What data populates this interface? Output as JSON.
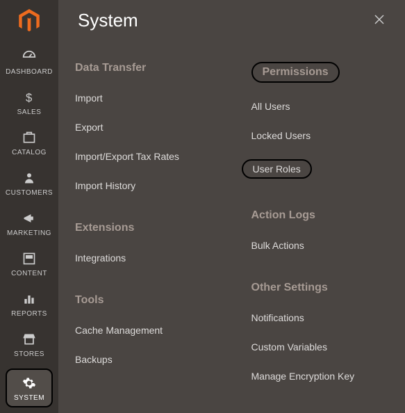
{
  "logo": {
    "alt": "Magento"
  },
  "sidebar": {
    "items": [
      {
        "label": "DASHBOARD"
      },
      {
        "label": "SALES"
      },
      {
        "label": "CATALOG"
      },
      {
        "label": "CUSTOMERS"
      },
      {
        "label": "MARKETING"
      },
      {
        "label": "CONTENT"
      },
      {
        "label": "REPORTS"
      },
      {
        "label": "STORES"
      },
      {
        "label": "SYSTEM"
      }
    ]
  },
  "panel": {
    "title": "System",
    "left": {
      "data_transfer": {
        "title": "Data Transfer",
        "items": [
          "Import",
          "Export",
          "Import/Export Tax Rates",
          "Import History"
        ]
      },
      "extensions": {
        "title": "Extensions",
        "items": [
          "Integrations"
        ]
      },
      "tools": {
        "title": "Tools",
        "items": [
          "Cache Management",
          "Backups"
        ]
      }
    },
    "right": {
      "permissions": {
        "title": "Permissions",
        "items": [
          "All Users",
          "Locked Users",
          "User Roles"
        ]
      },
      "action_logs": {
        "title": "Action Logs",
        "items": [
          "Bulk Actions"
        ]
      },
      "other_settings": {
        "title": "Other Settings",
        "items": [
          "Notifications",
          "Custom Variables",
          "Manage Encryption Key"
        ]
      }
    }
  }
}
